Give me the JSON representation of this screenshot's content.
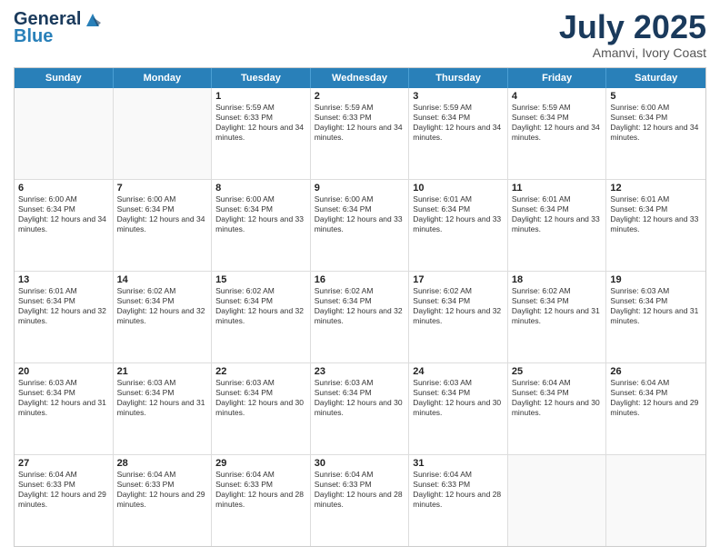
{
  "logo": {
    "line1": "General",
    "line2": "Blue"
  },
  "title": "July 2025",
  "location": "Amanvi, Ivory Coast",
  "days": [
    "Sunday",
    "Monday",
    "Tuesday",
    "Wednesday",
    "Thursday",
    "Friday",
    "Saturday"
  ],
  "weeks": [
    [
      {
        "day": "",
        "info": ""
      },
      {
        "day": "",
        "info": ""
      },
      {
        "day": "1",
        "info": "Sunrise: 5:59 AM\nSunset: 6:33 PM\nDaylight: 12 hours and 34 minutes."
      },
      {
        "day": "2",
        "info": "Sunrise: 5:59 AM\nSunset: 6:33 PM\nDaylight: 12 hours and 34 minutes."
      },
      {
        "day": "3",
        "info": "Sunrise: 5:59 AM\nSunset: 6:34 PM\nDaylight: 12 hours and 34 minutes."
      },
      {
        "day": "4",
        "info": "Sunrise: 5:59 AM\nSunset: 6:34 PM\nDaylight: 12 hours and 34 minutes."
      },
      {
        "day": "5",
        "info": "Sunrise: 6:00 AM\nSunset: 6:34 PM\nDaylight: 12 hours and 34 minutes."
      }
    ],
    [
      {
        "day": "6",
        "info": "Sunrise: 6:00 AM\nSunset: 6:34 PM\nDaylight: 12 hours and 34 minutes."
      },
      {
        "day": "7",
        "info": "Sunrise: 6:00 AM\nSunset: 6:34 PM\nDaylight: 12 hours and 34 minutes."
      },
      {
        "day": "8",
        "info": "Sunrise: 6:00 AM\nSunset: 6:34 PM\nDaylight: 12 hours and 33 minutes."
      },
      {
        "day": "9",
        "info": "Sunrise: 6:00 AM\nSunset: 6:34 PM\nDaylight: 12 hours and 33 minutes."
      },
      {
        "day": "10",
        "info": "Sunrise: 6:01 AM\nSunset: 6:34 PM\nDaylight: 12 hours and 33 minutes."
      },
      {
        "day": "11",
        "info": "Sunrise: 6:01 AM\nSunset: 6:34 PM\nDaylight: 12 hours and 33 minutes."
      },
      {
        "day": "12",
        "info": "Sunrise: 6:01 AM\nSunset: 6:34 PM\nDaylight: 12 hours and 33 minutes."
      }
    ],
    [
      {
        "day": "13",
        "info": "Sunrise: 6:01 AM\nSunset: 6:34 PM\nDaylight: 12 hours and 32 minutes."
      },
      {
        "day": "14",
        "info": "Sunrise: 6:02 AM\nSunset: 6:34 PM\nDaylight: 12 hours and 32 minutes."
      },
      {
        "day": "15",
        "info": "Sunrise: 6:02 AM\nSunset: 6:34 PM\nDaylight: 12 hours and 32 minutes."
      },
      {
        "day": "16",
        "info": "Sunrise: 6:02 AM\nSunset: 6:34 PM\nDaylight: 12 hours and 32 minutes."
      },
      {
        "day": "17",
        "info": "Sunrise: 6:02 AM\nSunset: 6:34 PM\nDaylight: 12 hours and 32 minutes."
      },
      {
        "day": "18",
        "info": "Sunrise: 6:02 AM\nSunset: 6:34 PM\nDaylight: 12 hours and 31 minutes."
      },
      {
        "day": "19",
        "info": "Sunrise: 6:03 AM\nSunset: 6:34 PM\nDaylight: 12 hours and 31 minutes."
      }
    ],
    [
      {
        "day": "20",
        "info": "Sunrise: 6:03 AM\nSunset: 6:34 PM\nDaylight: 12 hours and 31 minutes."
      },
      {
        "day": "21",
        "info": "Sunrise: 6:03 AM\nSunset: 6:34 PM\nDaylight: 12 hours and 31 minutes."
      },
      {
        "day": "22",
        "info": "Sunrise: 6:03 AM\nSunset: 6:34 PM\nDaylight: 12 hours and 30 minutes."
      },
      {
        "day": "23",
        "info": "Sunrise: 6:03 AM\nSunset: 6:34 PM\nDaylight: 12 hours and 30 minutes."
      },
      {
        "day": "24",
        "info": "Sunrise: 6:03 AM\nSunset: 6:34 PM\nDaylight: 12 hours and 30 minutes."
      },
      {
        "day": "25",
        "info": "Sunrise: 6:04 AM\nSunset: 6:34 PM\nDaylight: 12 hours and 30 minutes."
      },
      {
        "day": "26",
        "info": "Sunrise: 6:04 AM\nSunset: 6:34 PM\nDaylight: 12 hours and 29 minutes."
      }
    ],
    [
      {
        "day": "27",
        "info": "Sunrise: 6:04 AM\nSunset: 6:33 PM\nDaylight: 12 hours and 29 minutes."
      },
      {
        "day": "28",
        "info": "Sunrise: 6:04 AM\nSunset: 6:33 PM\nDaylight: 12 hours and 29 minutes."
      },
      {
        "day": "29",
        "info": "Sunrise: 6:04 AM\nSunset: 6:33 PM\nDaylight: 12 hours and 28 minutes."
      },
      {
        "day": "30",
        "info": "Sunrise: 6:04 AM\nSunset: 6:33 PM\nDaylight: 12 hours and 28 minutes."
      },
      {
        "day": "31",
        "info": "Sunrise: 6:04 AM\nSunset: 6:33 PM\nDaylight: 12 hours and 28 minutes."
      },
      {
        "day": "",
        "info": ""
      },
      {
        "day": "",
        "info": ""
      }
    ]
  ]
}
